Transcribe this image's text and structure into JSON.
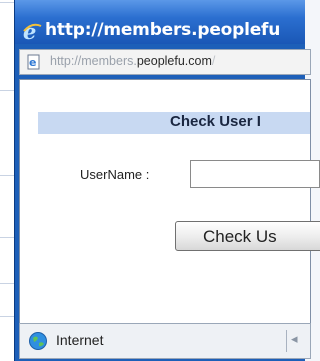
{
  "window": {
    "title": "http://members.peoplefu",
    "address": {
      "prefix": "http://members.",
      "domain": "peoplefu.com",
      "tail": "/"
    }
  },
  "form": {
    "heading": "Check User I",
    "username_label": "UserName :",
    "username_value": "",
    "button_label": "Check Us"
  },
  "statusbar": {
    "zone_label": "Internet"
  },
  "colors": {
    "titlebar": "#2b6fd0",
    "header_bar": "#c8d9f2"
  }
}
